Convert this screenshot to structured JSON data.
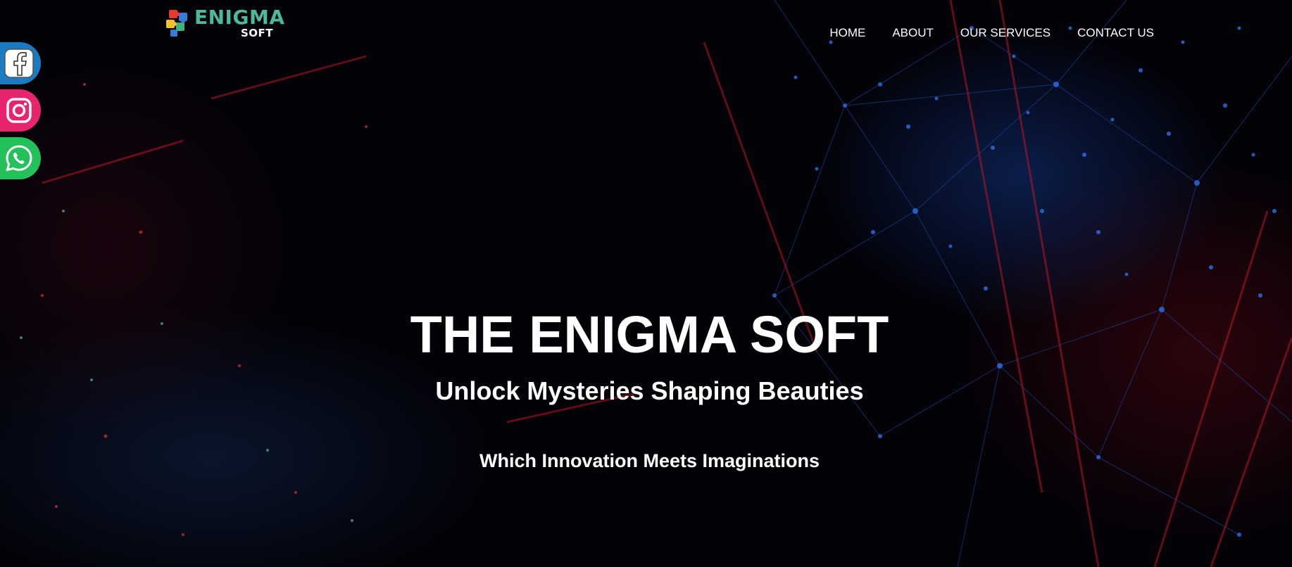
{
  "brand": {
    "name": "ENIGMA",
    "sub": "SOFT",
    "logo_icon": "puzzle-pieces-icon",
    "colors": {
      "brand_text": "#4db89a",
      "puzzle": [
        "#e63b2e",
        "#f2c12e",
        "#3a7bd5",
        "#3bb37a"
      ]
    }
  },
  "nav": {
    "items": [
      {
        "label": "HOME"
      },
      {
        "label": "ABOUT"
      },
      {
        "label": "OUR SERVICES"
      },
      {
        "label": "CONTACT US"
      }
    ]
  },
  "social": {
    "items": [
      {
        "name": "facebook",
        "icon": "facebook-icon",
        "color": "#1a7bc2"
      },
      {
        "name": "instagram",
        "icon": "instagram-icon",
        "color": "#e8246f"
      },
      {
        "name": "whatsapp",
        "icon": "whatsapp-icon",
        "color": "#22c15a"
      }
    ]
  },
  "hero": {
    "title": "THE ENIGMA SOFT",
    "subtitle": "Unlock Mysteries Shaping Beauties",
    "tagline": "Which Innovation Meets Imaginations"
  }
}
